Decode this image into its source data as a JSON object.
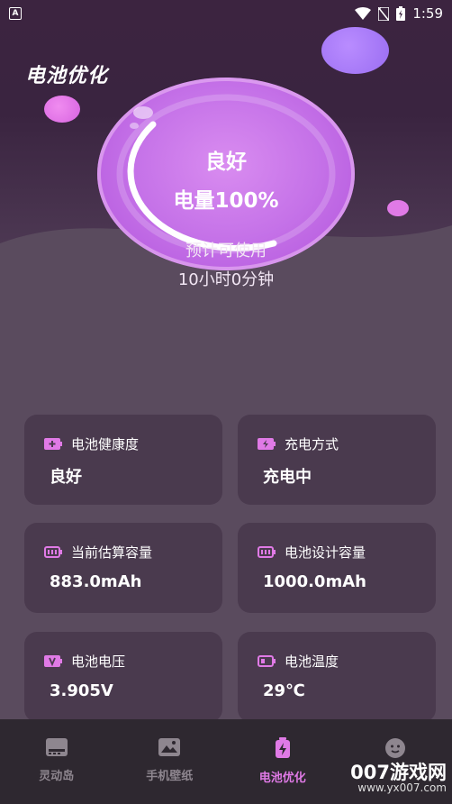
{
  "status_bar": {
    "left_icon": "A",
    "time": "1:59",
    "icons": [
      "wifi-icon",
      "sim-off-icon",
      "battery-charging-icon"
    ]
  },
  "page": {
    "title": "电池优化"
  },
  "battery": {
    "status": "良好",
    "level": "电量100%",
    "level_fraction": 1.0,
    "remaining_label": "预计可使用",
    "remaining_value": "10小时0分钟"
  },
  "cards": [
    {
      "label": "电池健康度",
      "value": "良好",
      "icon": "battery-plus-icon"
    },
    {
      "label": "充电方式",
      "value": "充电中",
      "icon": "battery-charging-icon"
    },
    {
      "label": "当前估算容量",
      "value": "883.0mAh",
      "icon": "battery-full-icon"
    },
    {
      "label": "电池设计容量",
      "value": "1000.0mAh",
      "icon": "battery-full-icon"
    },
    {
      "label": "电池电压",
      "value": "3.905V",
      "icon": "battery-voltage-icon"
    },
    {
      "label": "电池温度",
      "value": "29℃",
      "icon": "battery-temperature-icon"
    }
  ],
  "nav": [
    {
      "label": "灵动岛",
      "icon": "island-icon",
      "active": false
    },
    {
      "label": "手机壁纸",
      "icon": "wallpaper-icon",
      "active": false
    },
    {
      "label": "电池优化",
      "icon": "battery-bolt-icon",
      "active": true
    },
    {
      "label": "",
      "icon": "smiley-icon",
      "active": false
    }
  ],
  "watermark": {
    "line1": "007游戏网",
    "line2": "www.yx007.com"
  },
  "colors": {
    "accent": "#e07ae6",
    "card_bg": "#4a3a4e",
    "nav_bg": "#2e2830"
  }
}
